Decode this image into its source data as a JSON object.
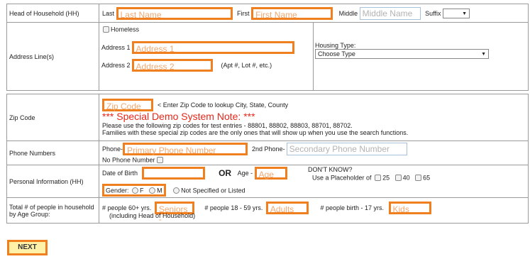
{
  "hh": {
    "label": "Head of Household  (HH)",
    "last_label": "Last",
    "last_ph": "Last Name",
    "first_label": "First",
    "first_ph": "First Name",
    "middle_label": "Middle",
    "middle_ph": "Middle Name",
    "suffix_label": "Suffix",
    "suffix_value": ""
  },
  "address": {
    "label": "Address Line(s)",
    "homeless": "Homeless",
    "addr1_label": "Address 1",
    "addr1_ph": "Address 1",
    "addr2_label": "Address 2",
    "addr2_ph": "Address 2",
    "addr2_hint": "(Apt #, Lot #, etc.)",
    "housing_label": "Housing Type:",
    "housing_value": "Choose Type"
  },
  "zip": {
    "label": "Zip Code",
    "ph": "Zip Code",
    "hint": "< Enter Zip Code to lookup City, State, County",
    "note_title": "*** Special Demo System Note: ***",
    "note_line1": "Please use the following zip codes for test entries - 88801, 88802, 88803, 88701, 88702.",
    "note_line2": "Families with these special zip codes are the only ones that will show up when you use the search functions."
  },
  "phone": {
    "label": "Phone Numbers",
    "phone_label": "Phone-",
    "phone_ph": "Primary Phone Number",
    "phone2_label": "2nd Phone-",
    "phone2_ph": "Secondary Phone Number",
    "no_phone": "No Phone Number"
  },
  "personal": {
    "label": "Personal Information  (HH)",
    "dob_label": "Date of Birth",
    "or": "OR",
    "age_label": "Age -",
    "age_ph": "Age",
    "dont_know": "DON'T KNOW?",
    "placeholder_label": "Use a Placeholder of",
    "opt25": "25",
    "opt40": "40",
    "opt65": "65",
    "gender_label": "Gender:",
    "f": "F",
    "m": "M",
    "not_specified": "Not Specified or Listed"
  },
  "people": {
    "label": "Total # of people in household by Age Group:",
    "seniors_label": "# people 60+ yrs.",
    "seniors_ph": "Seniors -",
    "including": "(including Head of Household)",
    "adults_label": "# people 18 - 59 yrs.",
    "adults_ph": "Adults",
    "kids_label": "# people birth - 17 yrs.",
    "kids_ph": "Kids"
  },
  "next_label": "NEXT",
  "colors": {
    "highlight": "#f07f1f",
    "note_red": "#e8271b",
    "next_bg": "#fff2a8"
  }
}
